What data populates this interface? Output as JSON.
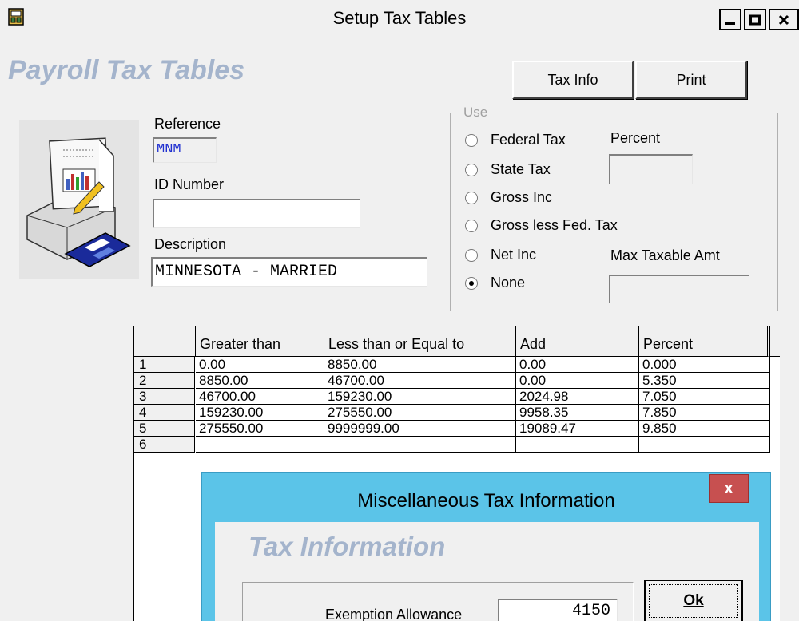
{
  "window": {
    "title": "Setup Tax Tables"
  },
  "header": {
    "title": "Payroll Tax Tables"
  },
  "buttons": {
    "tax_info": "Tax Info",
    "print": "Print"
  },
  "form": {
    "reference_label": "Reference",
    "reference_value": "MNM",
    "id_label": "ID Number",
    "id_value": "",
    "description_label": "Description",
    "description_value": "MINNESOTA - MARRIED"
  },
  "use_group": {
    "title": "Use",
    "options": [
      "Federal Tax",
      "State Tax",
      "Gross Inc",
      "Gross less Fed. Tax",
      "Net Inc",
      "None"
    ],
    "selected": "None",
    "percent_label": "Percent",
    "percent_value": "",
    "max_label": "Max Taxable Amt",
    "max_value": ""
  },
  "table": {
    "columns": [
      "Greater than",
      "Less than or Equal to",
      "Add",
      "Percent"
    ],
    "rows": [
      {
        "num": "1",
        "cells": [
          "0.00",
          "8850.00",
          "0.00",
          "0.000"
        ]
      },
      {
        "num": "2",
        "cells": [
          "8850.00",
          "46700.00",
          "0.00",
          "5.350"
        ]
      },
      {
        "num": "3",
        "cells": [
          "46700.00",
          "159230.00",
          "2024.98",
          "7.050"
        ]
      },
      {
        "num": "4",
        "cells": [
          "159230.00",
          "275550.00",
          "9958.35",
          "7.850"
        ]
      },
      {
        "num": "5",
        "cells": [
          "275550.00",
          "9999999.00",
          "19089.47",
          "9.850"
        ]
      },
      {
        "num": "6",
        "cells": [
          "",
          "",
          "",
          ""
        ]
      }
    ]
  },
  "dialog": {
    "title": "Miscellaneous Tax Information",
    "close": "x",
    "heading": "Tax Information",
    "exemption_label": "Exemption Allowance",
    "exemption_value": "4150",
    "ok_label": "Ok"
  }
}
